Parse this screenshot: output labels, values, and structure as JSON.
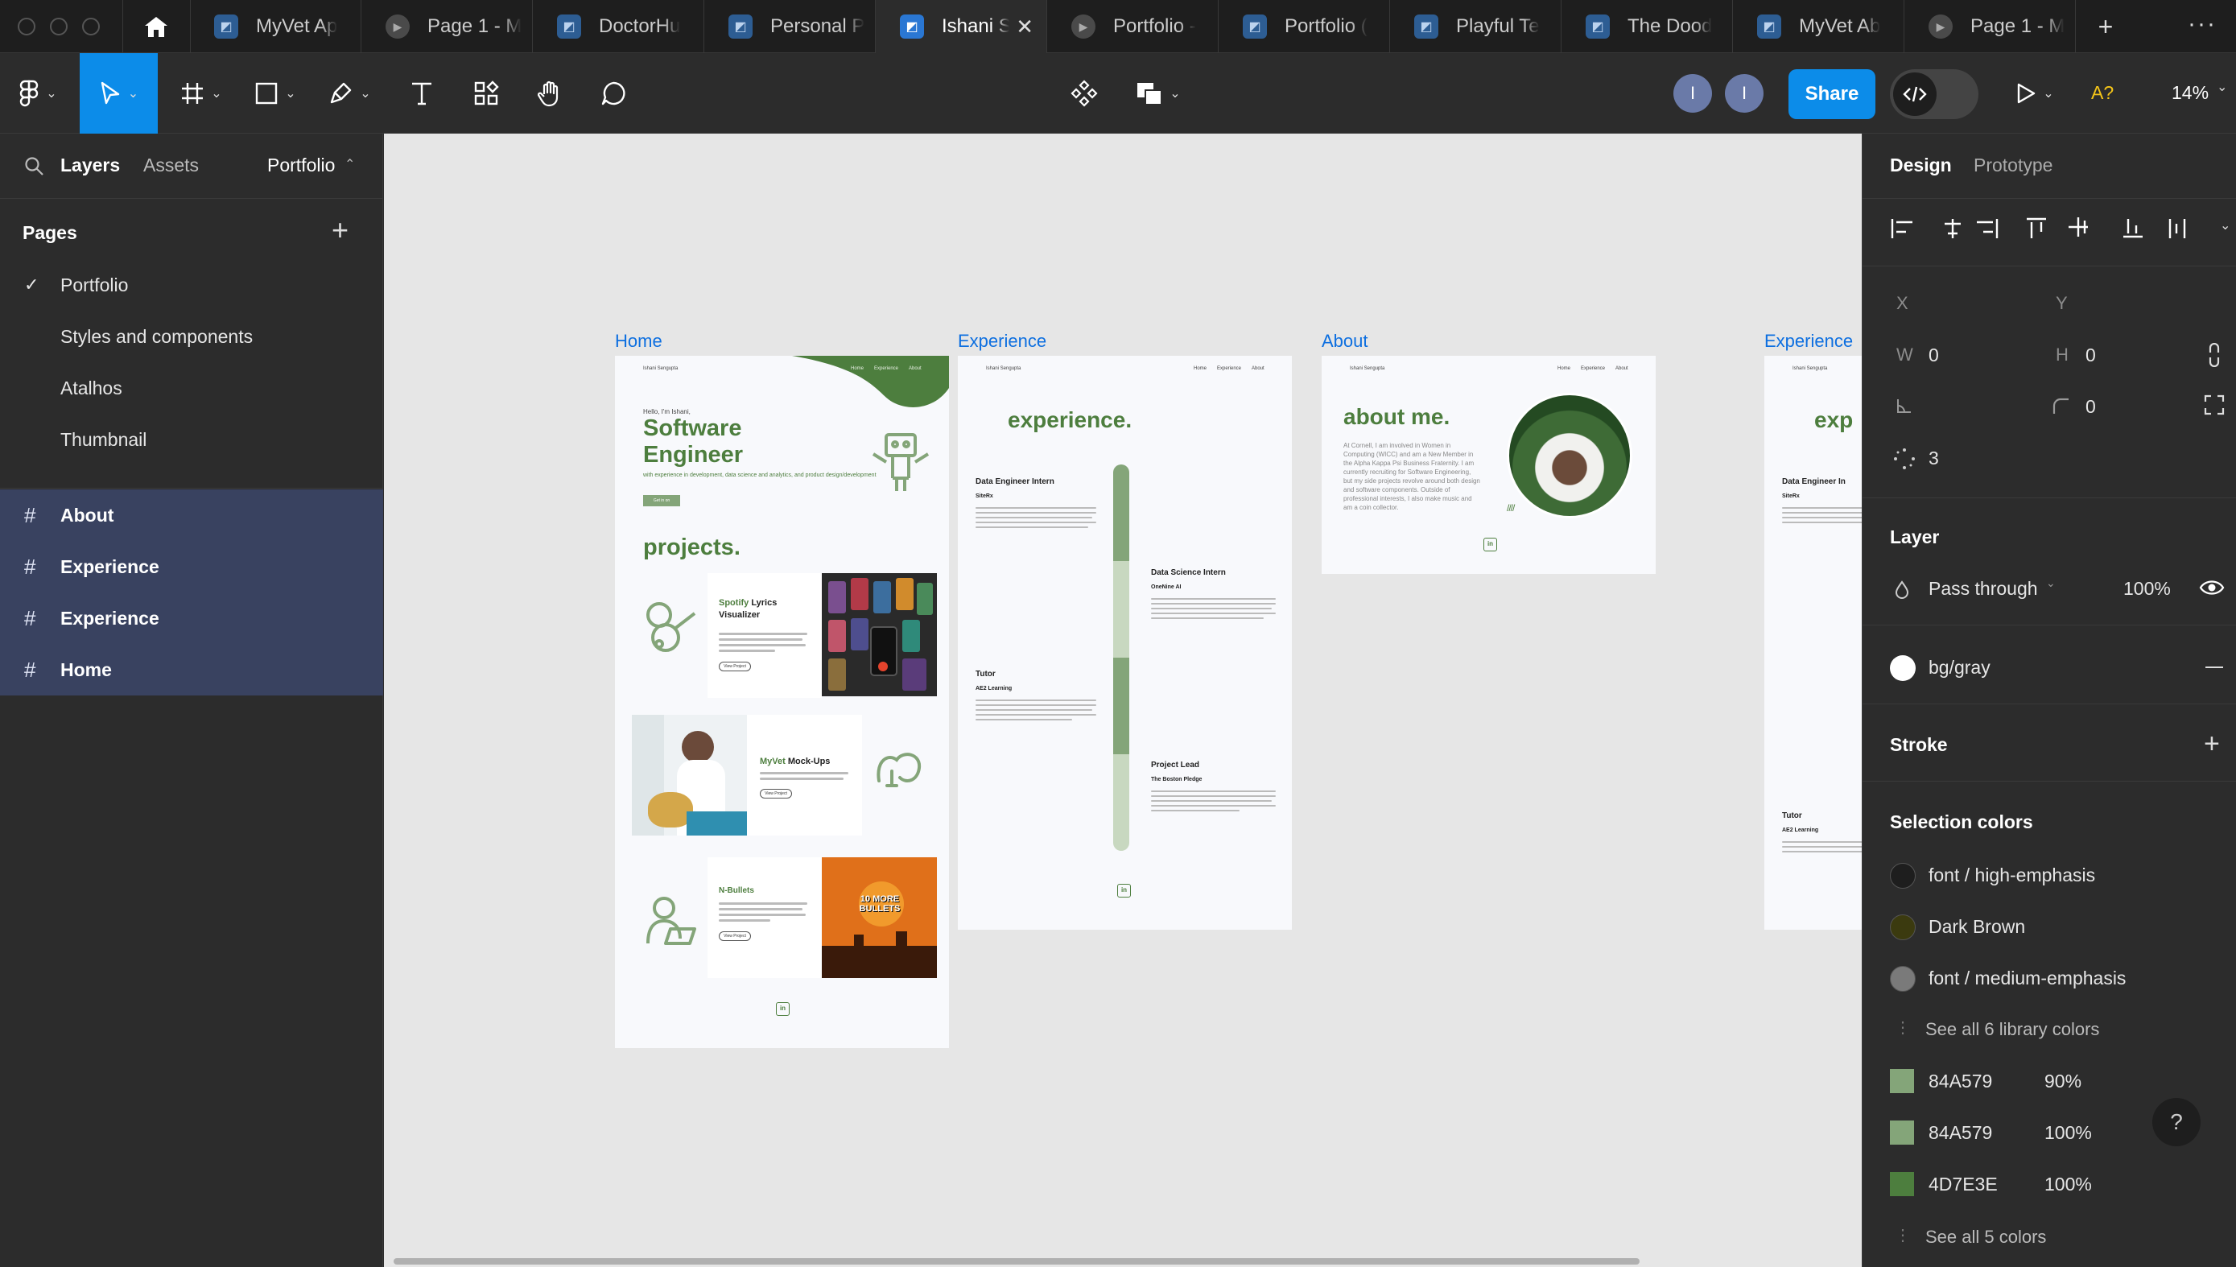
{
  "tabs": [
    {
      "label": "MyVet Ap",
      "kind": "figma"
    },
    {
      "label": "Page 1 - M",
      "kind": "proto"
    },
    {
      "label": "DoctorHu",
      "kind": "figma"
    },
    {
      "label": "Personal P",
      "kind": "figma"
    },
    {
      "label": "Ishani S",
      "kind": "figma",
      "active": true
    },
    {
      "label": "Portfolio -",
      "kind": "proto"
    },
    {
      "label": "Portfolio (",
      "kind": "figma"
    },
    {
      "label": "Playful Te",
      "kind": "figma"
    },
    {
      "label": "The Dood",
      "kind": "figma"
    },
    {
      "label": "MyVet Ab",
      "kind": "figma"
    },
    {
      "label": "Page 1 - M",
      "kind": "proto"
    }
  ],
  "toolbar": {
    "share_label": "Share",
    "avatar1": "I",
    "avatar2": "I",
    "font_badge": "A?",
    "zoom": "14%"
  },
  "left": {
    "tab_layers": "Layers",
    "tab_assets": "Assets",
    "page_switch": "Portfolio",
    "pages_heading": "Pages",
    "pages": [
      "Portfolio",
      "Styles and components",
      "Atalhos",
      "Thumbnail"
    ],
    "layers": [
      "About",
      "Experience",
      "Experience",
      "Home"
    ]
  },
  "canvas": {
    "labels": {
      "home": "Home",
      "exp1": "Experience",
      "about": "About",
      "exp2": "Experience"
    },
    "home": {
      "brand": "Ishani Sengupta",
      "nav": [
        "Home",
        "Experience",
        "About"
      ],
      "hello": "Hello, I'm Ishani,",
      "title1": "Software",
      "title2": "Engineer",
      "sub": "with experience in development, data science and analytics, and product design/development",
      "btn": "Get in on",
      "projects": "projects.",
      "p1_a": "Spotify",
      "p1_b": " Lyrics Visualizer",
      "p2_a": "MyVet",
      "p2_b": " Mock-Ups",
      "p3": "N-Bullets",
      "view": "View Project",
      "bullets_img": "10 MORE BULLETS"
    },
    "exp": {
      "brand": "Ishani Sengupta",
      "nav": [
        "Home",
        "Experience",
        "About"
      ],
      "title": "experience.",
      "items": [
        {
          "role": "Data Engineer Intern",
          "org": "SiteRx"
        },
        {
          "role": "Data Science Intern",
          "org": "OneNine AI"
        },
        {
          "role": "Tutor",
          "org": "AE2 Learning"
        },
        {
          "role": "Project Lead",
          "org": "The Boston Pledge"
        }
      ]
    },
    "about": {
      "brand": "Ishani Sengupta",
      "nav": [
        "Home",
        "Experience",
        "About"
      ],
      "title": "about me.",
      "body": "At Cornell, I am involved in Women in Computing (WICC) and am a New Member in the Alpha Kappa Psi Business Fraternity. I am currently recruiting for Software Engineering, but my side projects revolve around both design and software components. Outside of professional interests, I also make music and am a coin collector."
    },
    "exp2": {
      "brand": "Ishani Sengupta",
      "title": "exp",
      "role1": "Data Engineer In",
      "org1": "SiteRx",
      "role2": "Tutor",
      "org2": "AE2 Learning"
    }
  },
  "right": {
    "tab_design": "Design",
    "tab_prototype": "Prototype",
    "x_label": "X",
    "y_label": "Y",
    "w_label": "W",
    "w_value": "0",
    "h_label": "H",
    "h_value": "0",
    "radius_value": "0",
    "points_value": "3",
    "layer_heading": "Layer",
    "blend_mode": "Pass through",
    "opacity": "100%",
    "fill_name": "bg/gray",
    "stroke_heading": "Stroke",
    "selection_heading": "Selection colors",
    "colors": [
      {
        "name": "font / high-emphasis",
        "color": "#1e1e1e"
      },
      {
        "name": "Dark Brown",
        "color": "#3b3a0f"
      },
      {
        "name": "font / medium-emphasis",
        "color": "#7a7a7a"
      }
    ],
    "see_library": "See all 6 library colors",
    "hex_colors": [
      {
        "hex": "84A579",
        "opacity": "90%",
        "color": "#84a579"
      },
      {
        "hex": "84A579",
        "opacity": "100%",
        "color": "#84a579"
      },
      {
        "hex": "4D7E3E",
        "opacity": "100%",
        "color": "#4d7e3e"
      }
    ],
    "see_all": "See all 5 colors",
    "help": "?"
  }
}
